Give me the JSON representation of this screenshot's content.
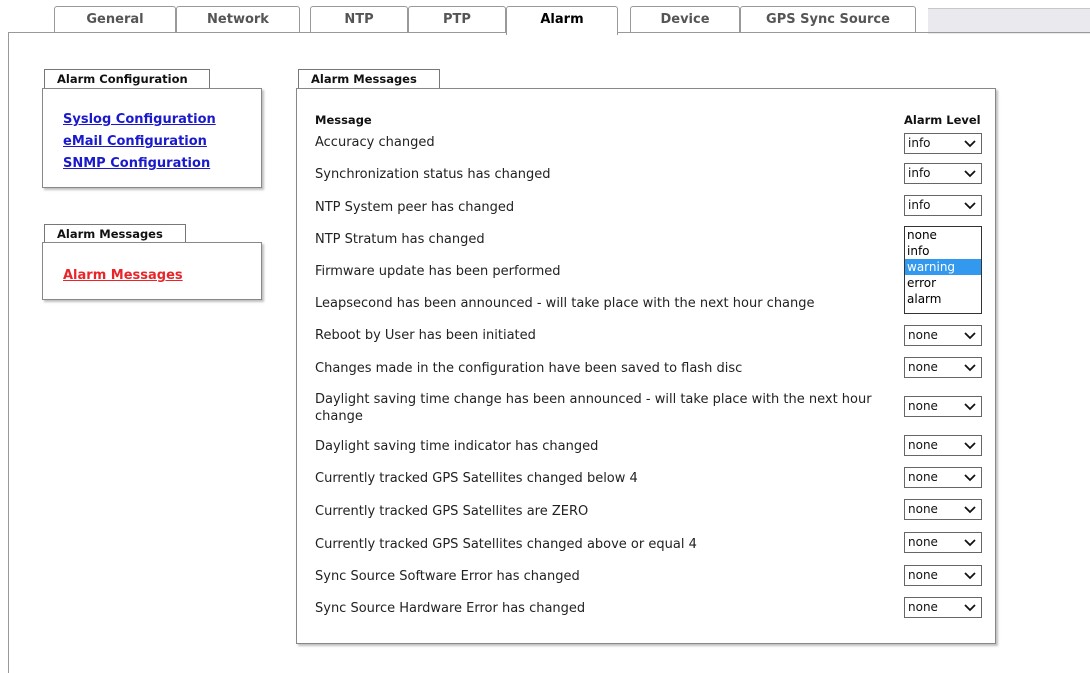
{
  "tabs": [
    {
      "label": "General"
    },
    {
      "label": "Network"
    },
    {
      "label": "NTP"
    },
    {
      "label": "PTP"
    },
    {
      "label": "Alarm"
    },
    {
      "label": "Device"
    },
    {
      "label": "GPS Sync Source"
    }
  ],
  "active_tab": "Alarm",
  "left": {
    "config_title": "Alarm Configuration",
    "config_links": [
      "Syslog Configuration",
      "eMail Configuration",
      "SNMP Configuration"
    ],
    "messages_title": "Alarm Messages",
    "messages_link": "Alarm Messages"
  },
  "main": {
    "title": "Alarm Messages",
    "col_message": "Message",
    "col_level": "Alarm Level",
    "rows": [
      {
        "message": "Accuracy changed",
        "level": "info"
      },
      {
        "message": "Synchronization status has changed",
        "level": "info"
      },
      {
        "message": "NTP System peer has changed",
        "level": "info"
      },
      {
        "message": "NTP Stratum has changed",
        "level": ""
      },
      {
        "message": "Firmware update has been performed",
        "level": ""
      },
      {
        "message": "Leapsecond has been announced - will take place with the next hour change",
        "level": ""
      },
      {
        "message": "Reboot by User has been initiated",
        "level": "none"
      },
      {
        "message": "Changes made in the configuration have been saved to flash disc",
        "level": "none"
      },
      {
        "message": "Daylight saving time change has been announced - will take place with the next hour change",
        "level": "none"
      },
      {
        "message": "Daylight saving time indicator has changed",
        "level": "none"
      },
      {
        "message": "Currently tracked GPS Satellites changed below 4",
        "level": "none"
      },
      {
        "message": "Currently tracked GPS Satellites are ZERO",
        "level": "none"
      },
      {
        "message": "Currently tracked GPS Satellites changed above or equal 4",
        "level": "none"
      },
      {
        "message": "Sync Source Software Error has changed",
        "level": "none"
      },
      {
        "message": "Sync Source Hardware Error has changed",
        "level": "none"
      }
    ],
    "dropdown_options": [
      "none",
      "info",
      "warning",
      "error",
      "alarm"
    ],
    "dropdown_highlighted": "warning"
  },
  "colors": {
    "link": "#1a1acc",
    "active_link": "#e8262a",
    "highlight": "#3399ee"
  }
}
